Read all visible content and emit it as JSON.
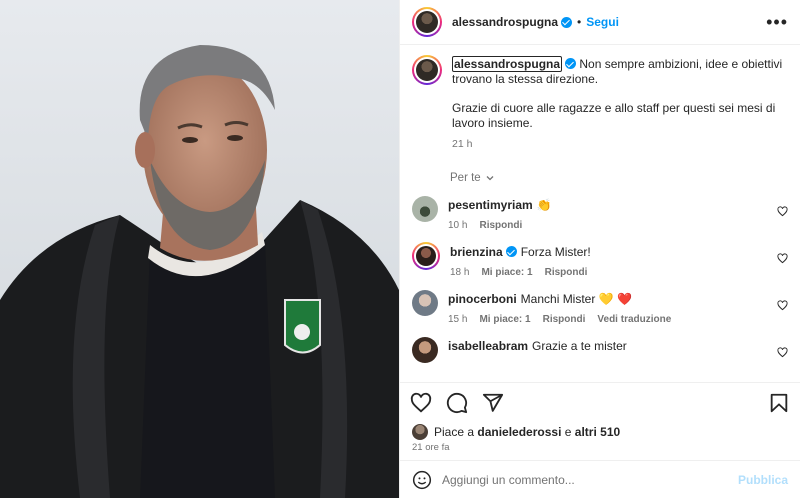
{
  "header": {
    "username": "alessandrospugna",
    "separator": "•",
    "follow_label": "Segui",
    "more_label": "•••"
  },
  "caption": {
    "username": "alessandrospugna",
    "line1": "Non sempre ambizioni, idee e obiettivi trovano la stessa direzione.",
    "line2": "Grazie di cuore alle ragazze e allo staff per questi sei mesi di lavoro insieme.",
    "time": "21 h"
  },
  "for_you_label": "Per te",
  "comments": [
    {
      "user": "pesentimyriam",
      "text": "👏",
      "time": "10 h",
      "likes": "",
      "reply": "Rispondi",
      "translate": ""
    },
    {
      "user": "brienzina",
      "text": "Forza Mister!",
      "time": "18 h",
      "likes": "Mi piace: 1",
      "reply": "Rispondi",
      "translate": ""
    },
    {
      "user": "pinocerboni",
      "text": "Manchi Mister 💛 ❤️",
      "time": "15 h",
      "likes": "Mi piace: 1",
      "reply": "Rispondi",
      "translate": "Vedi traduzione"
    },
    {
      "user": "isabelleabram",
      "text": "Grazie a te mister",
      "time": "",
      "likes": "",
      "reply": "",
      "translate": ""
    }
  ],
  "likes": {
    "prefix": "Piace a",
    "user": "danielederossi",
    "connector": "e",
    "others": "altri 510"
  },
  "posted_ago": "21 ore fa",
  "comment_box": {
    "placeholder": "Aggiungi un commento...",
    "publish_label": "Pubblica"
  },
  "colors": {
    "accent": "#0095f6",
    "publish_disabled": "#b2dffc",
    "muted": "#737373",
    "like_red": "#ed4956"
  },
  "icons": [
    "more-icon",
    "verified-icon",
    "chevron-down-icon",
    "heart-icon",
    "comment-icon",
    "share-icon",
    "bookmark-icon",
    "emoji-icon"
  ]
}
